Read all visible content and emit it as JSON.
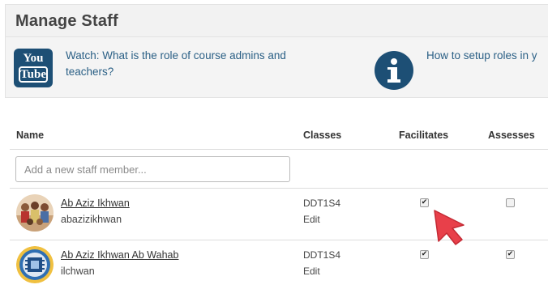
{
  "panel": {
    "title": "Manage Staff",
    "youtube_icon": {
      "name": "youtube-icon",
      "top_text": "You",
      "bottom_text": "Tube",
      "color": "#1d4f75"
    },
    "watch_link": "Watch: What is the role of course admins and teachers?",
    "info_icon": "info-icon",
    "howto_link": "How to setup roles in y"
  },
  "table": {
    "headers": {
      "name": "Name",
      "classes": "Classes",
      "facilitates": "Facilitates",
      "assesses": "Assesses"
    },
    "add_staff_placeholder": "Add a new staff member...",
    "rows": [
      {
        "name": "Ab Aziz Ikhwan",
        "username": "abazizikhwan",
        "class": "DDT1S4",
        "edit": "Edit",
        "facilitates": true,
        "assesses": false
      },
      {
        "name": "Ab Aziz Ikhwan Ab Wahab",
        "username": "ilchwan",
        "class": "DDT1S4",
        "edit": "Edit",
        "facilitates": true,
        "assesses": true
      }
    ]
  },
  "cursor_icon": "red-arrow-cursor-icon",
  "colors": {
    "link": "#2a5f85",
    "icon_blue": "#1d4f75",
    "cursor_red": "#e8404a"
  }
}
